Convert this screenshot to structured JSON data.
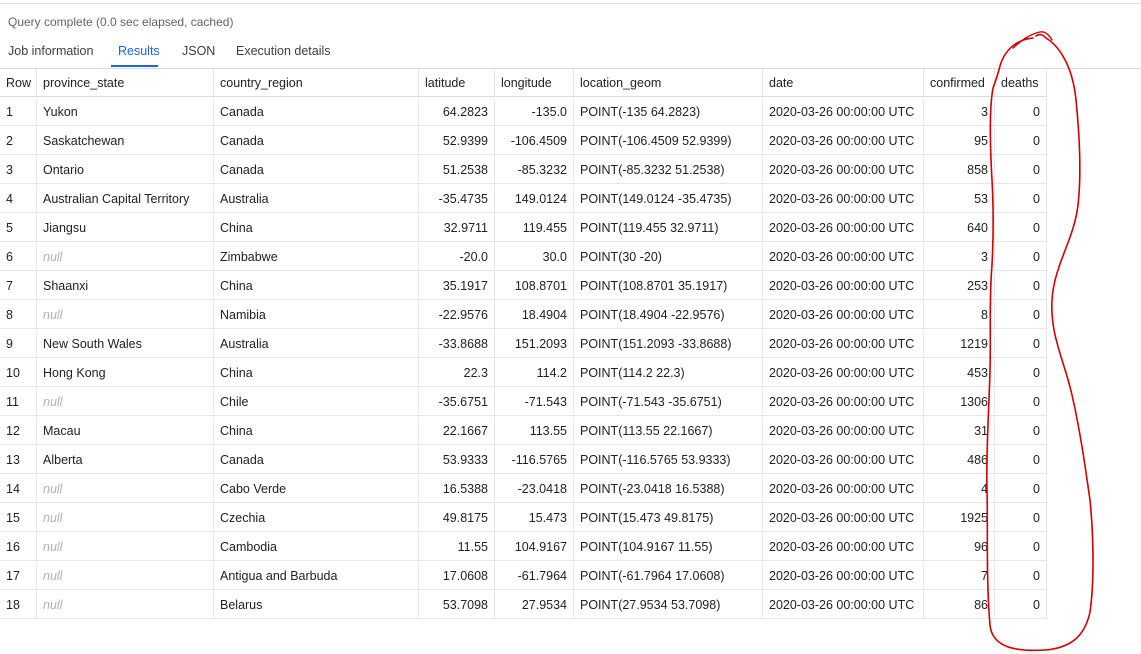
{
  "status": "Query complete (0.0 sec elapsed, cached)",
  "tabs": [
    {
      "label": "Job information",
      "active": false
    },
    {
      "label": "Results",
      "active": true
    },
    {
      "label": "JSON",
      "active": false
    },
    {
      "label": "Execution details",
      "active": false
    }
  ],
  "columns": [
    "Row",
    "province_state",
    "country_region",
    "latitude",
    "longitude",
    "location_geom",
    "date",
    "confirmed",
    "deaths"
  ],
  "rows": [
    [
      "1",
      "Yukon",
      "Canada",
      "64.2823",
      "-135.0",
      "POINT(-135 64.2823)",
      "2020-03-26 00:00:00 UTC",
      "3",
      "0"
    ],
    [
      "2",
      "Saskatchewan",
      "Canada",
      "52.9399",
      "-106.4509",
      "POINT(-106.4509 52.9399)",
      "2020-03-26 00:00:00 UTC",
      "95",
      "0"
    ],
    [
      "3",
      "Ontario",
      "Canada",
      "51.2538",
      "-85.3232",
      "POINT(-85.3232 51.2538)",
      "2020-03-26 00:00:00 UTC",
      "858",
      "0"
    ],
    [
      "4",
      "Australian Capital Territory",
      "Australia",
      "-35.4735",
      "149.0124",
      "POINT(149.0124 -35.4735)",
      "2020-03-26 00:00:00 UTC",
      "53",
      "0"
    ],
    [
      "5",
      "Jiangsu",
      "China",
      "32.9711",
      "119.455",
      "POINT(119.455 32.9711)",
      "2020-03-26 00:00:00 UTC",
      "640",
      "0"
    ],
    [
      "6",
      "null",
      "Zimbabwe",
      "-20.0",
      "30.0",
      "POINT(30 -20)",
      "2020-03-26 00:00:00 UTC",
      "3",
      "0"
    ],
    [
      "7",
      "Shaanxi",
      "China",
      "35.1917",
      "108.8701",
      "POINT(108.8701 35.1917)",
      "2020-03-26 00:00:00 UTC",
      "253",
      "0"
    ],
    [
      "8",
      "null",
      "Namibia",
      "-22.9576",
      "18.4904",
      "POINT(18.4904 -22.9576)",
      "2020-03-26 00:00:00 UTC",
      "8",
      "0"
    ],
    [
      "9",
      "New South Wales",
      "Australia",
      "-33.8688",
      "151.2093",
      "POINT(151.2093 -33.8688)",
      "2020-03-26 00:00:00 UTC",
      "1219",
      "0"
    ],
    [
      "10",
      "Hong Kong",
      "China",
      "22.3",
      "114.2",
      "POINT(114.2 22.3)",
      "2020-03-26 00:00:00 UTC",
      "453",
      "0"
    ],
    [
      "11",
      "null",
      "Chile",
      "-35.6751",
      "-71.543",
      "POINT(-71.543 -35.6751)",
      "2020-03-26 00:00:00 UTC",
      "1306",
      "0"
    ],
    [
      "12",
      "Macau",
      "China",
      "22.1667",
      "113.55",
      "POINT(113.55 22.1667)",
      "2020-03-26 00:00:00 UTC",
      "31",
      "0"
    ],
    [
      "13",
      "Alberta",
      "Canada",
      "53.9333",
      "-116.5765",
      "POINT(-116.5765 53.9333)",
      "2020-03-26 00:00:00 UTC",
      "486",
      "0"
    ],
    [
      "14",
      "null",
      "Cabo Verde",
      "16.5388",
      "-23.0418",
      "POINT(-23.0418 16.5388)",
      "2020-03-26 00:00:00 UTC",
      "4",
      "0"
    ],
    [
      "15",
      "null",
      "Czechia",
      "49.8175",
      "15.473",
      "POINT(15.473 49.8175)",
      "2020-03-26 00:00:00 UTC",
      "1925",
      "0"
    ],
    [
      "16",
      "null",
      "Cambodia",
      "11.55",
      "104.9167",
      "POINT(104.9167 11.55)",
      "2020-03-26 00:00:00 UTC",
      "96",
      "0"
    ],
    [
      "17",
      "null",
      "Antigua and Barbuda",
      "17.0608",
      "-61.7964",
      "POINT(-61.7964 17.0608)",
      "2020-03-26 00:00:00 UTC",
      "7",
      "0"
    ],
    [
      "18",
      "null",
      "Belarus",
      "53.7098",
      "27.9534",
      "POINT(27.9534 53.7098)",
      "2020-03-26 00:00:00 UTC",
      "86",
      "0"
    ]
  ],
  "colors": {
    "accent": "#1967d2",
    "annotation": "#d10000",
    "null_text": "#b0b0b0"
  }
}
